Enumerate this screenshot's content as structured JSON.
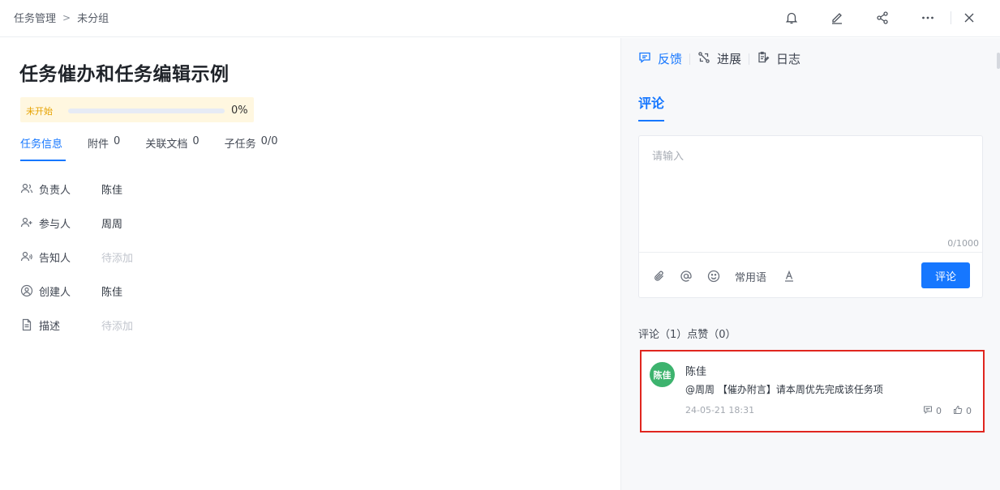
{
  "breadcrumb": {
    "root": "任务管理",
    "sep": ">",
    "current": "未分组"
  },
  "top_actions": [
    "bell-icon",
    "edit-icon",
    "share-icon",
    "more-icon",
    "close-icon"
  ],
  "task": {
    "title": "任务催办和任务编辑示例",
    "status": "未开始",
    "progress": 0,
    "progress_label": "0%"
  },
  "tabs": [
    {
      "label": "任务信息",
      "count": ""
    },
    {
      "label": "附件",
      "count": "0"
    },
    {
      "label": "关联文档",
      "count": "0"
    },
    {
      "label": "子任务",
      "count": "0/0"
    }
  ],
  "fields": [
    {
      "icon": "owner-icon",
      "label": "负责人",
      "value": "陈佳",
      "placeholder": false
    },
    {
      "icon": "participant-icon",
      "label": "参与人",
      "value": "周周",
      "placeholder": false
    },
    {
      "icon": "notify-icon",
      "label": "告知人",
      "value": "待添加",
      "placeholder": true
    },
    {
      "icon": "creator-icon",
      "label": "创建人",
      "value": "陈佳",
      "placeholder": false
    },
    {
      "icon": "document-icon",
      "label": "描述",
      "value": "待添加",
      "placeholder": true
    }
  ],
  "right_tabs": [
    {
      "icon": "feedback-icon",
      "label": "反馈"
    },
    {
      "icon": "progress-icon",
      "label": "进展"
    },
    {
      "icon": "log-icon",
      "label": "日志"
    }
  ],
  "comment_section": {
    "heading": "评论",
    "input_placeholder": "请输入",
    "char_count": "0/1000",
    "phrases_label": "常用语",
    "submit_label": "评论",
    "stats": "评论（1）点赞（0）"
  },
  "comments": [
    {
      "avatar_text": "陈佳",
      "author": "陈佳",
      "text": "@周周 【催办附言】请本周优先完成该任务项",
      "time": "24-05-21 18:31",
      "reply_count": "0",
      "like_count": "0"
    }
  ],
  "colors": {
    "accent": "#1677ff",
    "status_bg": "#fff7e0",
    "status_text": "#e6a200",
    "avatar_bg": "#3db36e",
    "highlight_border": "#e0261f"
  }
}
